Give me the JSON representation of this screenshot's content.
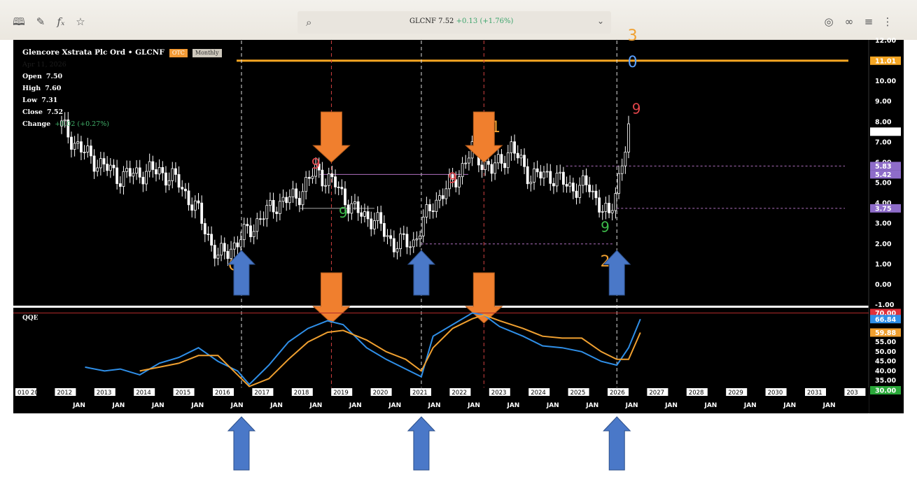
{
  "toolbar": {
    "left_icons": [
      "book-icon",
      "pencil-icon",
      "function-icon",
      "star-icon"
    ],
    "right_icons": [
      "camera-icon",
      "link-icon",
      "layers-icon",
      "more-icon"
    ]
  },
  "search": {
    "symbol": "GLCNF",
    "price": "7.52",
    "change": "+0.13",
    "change_pct": "(+1.76%)"
  },
  "legend": {
    "name": "Glencore Xstrata Plc Ord • GLCNF",
    "exchange": "OTC",
    "interval": "Monthly",
    "date": "Apr 11, 2026",
    "open_label": "Open",
    "open": "7.50",
    "high_label": "High",
    "high": "7.60",
    "low_label": "Low",
    "low": "7.31",
    "close_label": "Close",
    "close": "7.52",
    "change_label": "Change",
    "change": "+0.02 (+0.27%)"
  },
  "colors": {
    "price_candles": "#ffffff",
    "qqe_fast": "#2f8fe8",
    "qqe_slow": "#f0a030",
    "resistance": "#f5a623",
    "arrow_down": "#f07f2e",
    "arrow_up": "#4a78c8",
    "green_marker": "#3dbb4a",
    "red_marker": "#e0454a"
  },
  "chart_data": [
    {
      "type": "candlestick",
      "interval": "monthly",
      "x": [
        2011.5,
        2012,
        2012.5,
        2013,
        2013.5,
        2014,
        2014.5,
        2015,
        2015.5,
        2016,
        2016.5,
        2017,
        2017.5,
        2018,
        2018.5,
        2019,
        2019.5,
        2020,
        2020.5,
        2021,
        2021.5,
        2022,
        2022.5,
        2023,
        2023.5,
        2024,
        2024.5,
        2025,
        2025.5,
        2026
      ],
      "values": [
        7.8,
        6.6,
        5.9,
        5.3,
        5.5,
        5.6,
        5.0,
        3.5,
        1.3,
        2.1,
        3.1,
        4.0,
        4.3,
        5.6,
        4.9,
        3.6,
        3.2,
        2.0,
        2.1,
        4.0,
        5.0,
        6.6,
        5.6,
        6.7,
        5.3,
        5.4,
        4.8,
        4.8,
        3.2,
        7.52
      ],
      "ylim": [
        -1,
        12
      ],
      "y_ticks": [
        12.0,
        11.0,
        10.0,
        9.0,
        8.0,
        7.0,
        6.0,
        5.0,
        4.0,
        3.0,
        2.0,
        1.0,
        0.0,
        -1.0
      ],
      "price_tags": [
        {
          "value": 11.01,
          "label": "11.01"
        },
        {
          "value": 7.52,
          "label": ""
        },
        {
          "value": 5.83,
          "label": "5.83"
        },
        {
          "value": 5.42,
          "label": "5.42"
        },
        {
          "value": 3.75,
          "label": "3.75"
        }
      ],
      "resistance": 11.01,
      "wave_labels": [
        {
          "label": "3",
          "x": 2026.1,
          "y": 12.0
        },
        {
          "label": "1",
          "x": 2022.6,
          "y": 7.5
        },
        {
          "label": "2",
          "x": 2025.4,
          "y": 0.9
        },
        {
          "label": "0",
          "x": 2026.1,
          "y": 10.7
        },
        {
          "label": "C",
          "x": 2015.9,
          "y": 0.7
        }
      ],
      "td_counts": [
        {
          "label": "9",
          "x": 2018.0,
          "y": 5.7,
          "color": "red"
        },
        {
          "label": "9",
          "x": 2018.7,
          "y": 3.3,
          "color": "green"
        },
        {
          "label": "9",
          "x": 2021.5,
          "y": 5.0,
          "color": "red"
        },
        {
          "label": "9",
          "x": 2025.4,
          "y": 2.6,
          "color": "green"
        },
        {
          "label": "9",
          "x": 2026.2,
          "y": 8.4,
          "color": "red"
        }
      ],
      "x_years": [
        "010 2011",
        "2012",
        "2013",
        "2014",
        "2015",
        "2016",
        "2017",
        "2018",
        "2019",
        "2020",
        "2021",
        "2022",
        "2023",
        "2024",
        "2025",
        "2026",
        "2027",
        "2028",
        "2029",
        "2030",
        "2031",
        "203"
      ],
      "x_months": [
        "JAN",
        "JAN",
        "JAN",
        "JAN",
        "JAN",
        "JAN",
        "JAN",
        "JAN",
        "JAN",
        "JAN",
        "JAN",
        "JAN",
        "JAN",
        "JAN",
        "JAN",
        "JAN",
        "JAN",
        "JAN",
        "JAN",
        "JAN"
      ],
      "vertical_markers": [
        {
          "x": 2016.1,
          "color": "white"
        },
        {
          "x": 2018.4,
          "color": "red"
        },
        {
          "x": 2020.7,
          "color": "white"
        },
        {
          "x": 2022.3,
          "color": "red"
        },
        {
          "x": 2025.7,
          "color": "white"
        }
      ],
      "down_arrows": [
        2018.4,
        2022.3
      ],
      "up_arrows": [
        2016.1,
        2020.7,
        2025.7
      ]
    },
    {
      "type": "line",
      "title": "QQE",
      "ylim": [
        30,
        72
      ],
      "y_ticks": [
        55.0,
        50.0,
        45.0,
        40.0,
        35.0
      ],
      "levels": [
        {
          "value": 70.0,
          "label": "70.00"
        },
        {
          "value": 30.0,
          "label": "30.00"
        }
      ],
      "x": [
        2012.1,
        2012.6,
        2013.0,
        2013.5,
        2014.0,
        2014.5,
        2015.0,
        2015.5,
        2016.0,
        2016.3,
        2016.8,
        2017.3,
        2017.8,
        2018.3,
        2018.7,
        2019.3,
        2019.8,
        2020.3,
        2020.7,
        2021.0,
        2021.5,
        2022.0,
        2022.3,
        2022.7,
        2023.3,
        2023.8,
        2024.3,
        2024.8,
        2025.3,
        2025.7,
        2026.0,
        2026.3
      ],
      "series": [
        {
          "name": "",
          "values": [
            42,
            40,
            41,
            38,
            44,
            47,
            52,
            45,
            40,
            33,
            43,
            55,
            62,
            66,
            64,
            52,
            46,
            41,
            37,
            58,
            64,
            70,
            69,
            63,
            58,
            53,
            52,
            50,
            45,
            43,
            52,
            66.84
          ]
        },
        {
          "name": "",
          "values": [
            null,
            null,
            null,
            40,
            42,
            44,
            48,
            48,
            38,
            32,
            36,
            46,
            55,
            60,
            61,
            56,
            50,
            46,
            40,
            52,
            62,
            67,
            69,
            66,
            62,
            58,
            57,
            57,
            50,
            46,
            46,
            59.88
          ]
        }
      ],
      "value_tags": [
        {
          "value": 66.84,
          "label": "66.84"
        },
        {
          "value": 59.88,
          "label": "59.88"
        }
      ]
    }
  ]
}
